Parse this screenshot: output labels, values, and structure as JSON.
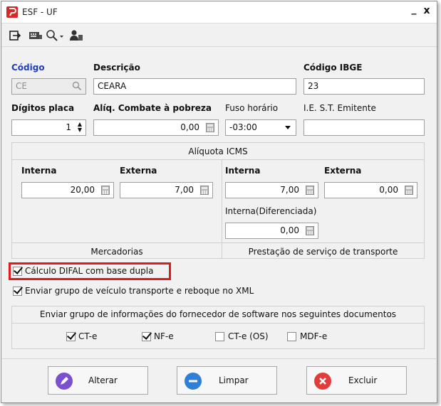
{
  "window": {
    "title": "ESF - UF",
    "minimize_glyph": "_",
    "close_glyph": "x"
  },
  "toolbar": {
    "icons": [
      "export-icon",
      "keyboard-card-icon",
      "search-dropdown-icon",
      "users-icon"
    ]
  },
  "form": {
    "codigo": {
      "label": "Código",
      "value": "CE"
    },
    "descricao": {
      "label": "Descrição",
      "value": "CEARA"
    },
    "codigo_ibge": {
      "label": "Código IBGE",
      "value": "23"
    },
    "digitos_placa": {
      "label": "Dígitos placa",
      "value": "1"
    },
    "aliq_pobreza": {
      "label": "Alíq. Combate à pobreza",
      "value": "0,00"
    },
    "fuso_horario": {
      "label": "Fuso horário",
      "value": "-03:00"
    },
    "ie_st": {
      "label": "I.E. S.T. Emitente",
      "value": ""
    }
  },
  "icms": {
    "title": "Alíquota ICMS",
    "mercadorias": {
      "caption": "Mercadorias",
      "interna_label": "Interna",
      "interna_value": "20,00",
      "externa_label": "Externa",
      "externa_value": "7,00"
    },
    "transporte": {
      "caption": "Prestação de serviço de transporte",
      "interna_label": "Interna",
      "interna_value": "7,00",
      "externa_label": "Externa",
      "externa_value": "0,00",
      "diferenciada_label": "Interna(Diferenciada)",
      "diferenciada_value": "0,00"
    }
  },
  "options": {
    "difal": {
      "label": "Cálculo DIFAL com base dupla",
      "checked": true
    },
    "veiculo": {
      "label": "Enviar grupo de veículo transporte e reboque no XML",
      "checked": true
    }
  },
  "software_docs": {
    "title": "Enviar grupo de informações do fornecedor de software nos seguintes documentos",
    "items": [
      {
        "label": "CT-e",
        "checked": true
      },
      {
        "label": "NF-e",
        "checked": true
      },
      {
        "label": "CT-e (OS)",
        "checked": false
      },
      {
        "label": "MDF-e",
        "checked": false
      }
    ]
  },
  "buttons": {
    "alterar": "Alterar",
    "limpar": "Limpar",
    "excluir": "Excluir"
  },
  "colors": {
    "accent_blue": "#1f3fbf",
    "highlight_red": "#e01b1b",
    "alterar_icon": "#7b4fcf",
    "limpar_icon": "#2f7fd6",
    "excluir_icon": "#e23b3b"
  }
}
